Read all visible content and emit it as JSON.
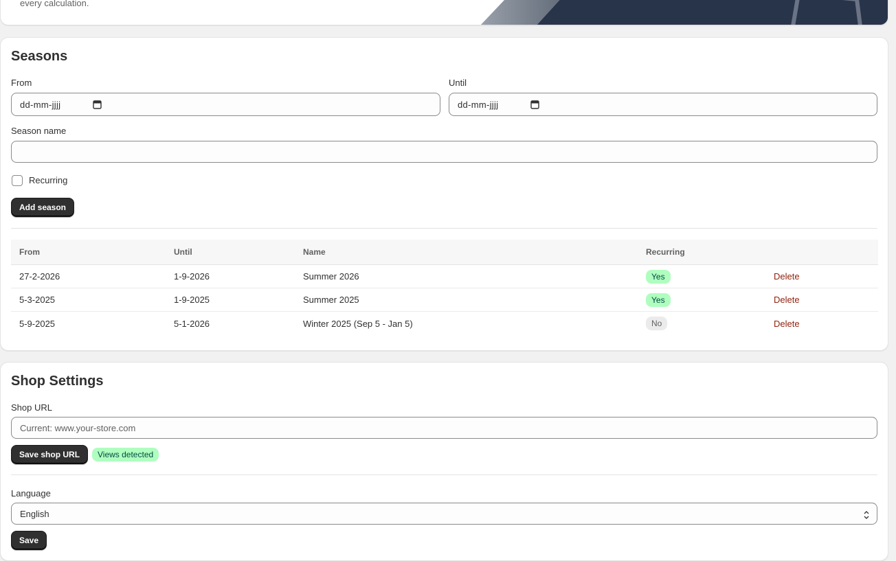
{
  "hero": {
    "text": "every calculation."
  },
  "seasons": {
    "title": "Seasons",
    "from_label": "From",
    "until_label": "Until",
    "from_value": "dd-mm-jjjj",
    "until_value": "dd-mm-jjjj",
    "season_name_label": "Season name",
    "season_name_value": "",
    "recurring_label": "Recurring",
    "recurring_checked": false,
    "add_button": "Add season",
    "table": {
      "headers": [
        "From",
        "Until",
        "Name",
        "Recurring",
        ""
      ],
      "rows": [
        {
          "from": "27-2-2026",
          "until": "1-9-2026",
          "name": "Summer 2026",
          "recurring": "Yes",
          "action": "Delete"
        },
        {
          "from": "5-3-2025",
          "until": "1-9-2025",
          "name": "Summer 2025",
          "recurring": "Yes",
          "action": "Delete"
        },
        {
          "from": "5-9-2025",
          "until": "5-1-2026",
          "name": "Winter 2025 (Sep 5 - Jan 5)",
          "recurring": "No",
          "action": "Delete"
        }
      ]
    }
  },
  "shop": {
    "title": "Shop Settings",
    "url_label": "Shop URL",
    "url_placeholder": "Current: www.your-store.com",
    "save_url_button": "Save shop URL",
    "views_badge": "Views detected",
    "language_label": "Language",
    "language_value": "English",
    "save_button": "Save"
  },
  "colors": {
    "page_bg": "#f1f1f1",
    "button_dark": "#303030",
    "badge_success_bg": "#affebf",
    "badge_neutral_bg": "#ebebeb",
    "delete_text": "#8e1f0b",
    "hero_art": "#1f2a3e"
  }
}
